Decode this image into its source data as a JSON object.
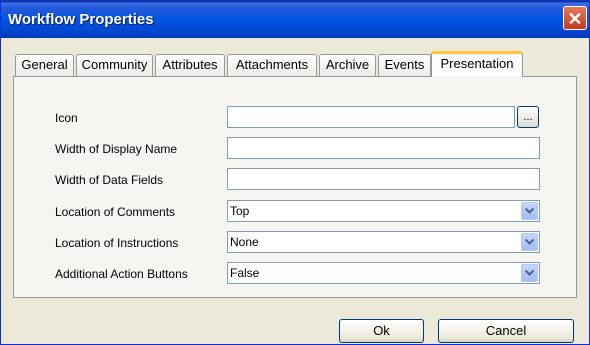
{
  "window": {
    "title": "Workflow Properties",
    "close_glyph": "✕"
  },
  "tabs": [
    "General",
    "Community",
    "Attributes",
    "Attachments",
    "Archive",
    "Events",
    "Presentation"
  ],
  "active_tab": "Presentation",
  "form": {
    "icon_label": "Icon",
    "icon_value": "",
    "browse_label": "...",
    "display_name_width_label": "Width of Display Name",
    "display_name_width_value": "",
    "data_fields_width_label": "Width of Data Fields",
    "data_fields_width_value": "",
    "comments_location_label": "Location of Comments",
    "comments_location_value": "Top",
    "instructions_location_label": "Location of Instructions",
    "instructions_location_value": "None",
    "action_buttons_label": "Additional Action Buttons",
    "action_buttons_value": "False"
  },
  "buttons": {
    "ok": "Ok",
    "cancel": "Cancel"
  },
  "colors": {
    "titlebar": "#0054e3",
    "active_tab_highlight": "#ffc83c",
    "close_button": "#c4391a"
  },
  "icons": [
    "close-icon",
    "dropdown-arrow-icon"
  ]
}
